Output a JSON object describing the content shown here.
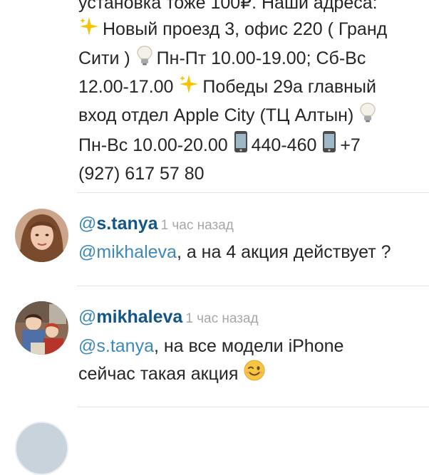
{
  "previous_comment": {
    "lines": [
      "установка тоже 100₽. Наши адреса:",
      "Новый проезд 3, офис 220 ( Гранд",
      "Сити )",
      "Пн-Пт 10.00-19.00; Сб-Вс",
      "12.00-17.00",
      "Победы 29а главный",
      "вход отдел Apple City (ТЦ Алтын)",
      "Пн-Вс 10.00-20.00",
      "440-460",
      "+7",
      "(927) 617 57 80"
    ]
  },
  "comments": [
    {
      "at": "@",
      "username": "s.tanya",
      "timestamp": "1 час назад",
      "mention": "@mikhaleva",
      "text": ", а на 4 акция действует ?"
    },
    {
      "at": "@",
      "username": "mikhaleva",
      "timestamp": "1 час назад",
      "mention": "@s.tanya",
      "text_line1": ", на все модели iPhone",
      "text_line2": "сейчас такая акция"
    }
  ],
  "icons": {
    "sparkles": "sparkles-icon",
    "lightbulb": "lightbulb-icon",
    "phone": "mobile-phone-icon",
    "wink": "winking-face-icon"
  },
  "colors": {
    "username": "#125688",
    "mention": "#3d88b8",
    "timestamp": "#a5a7aa",
    "text": "#262626",
    "divider": "#e3e3e3"
  }
}
